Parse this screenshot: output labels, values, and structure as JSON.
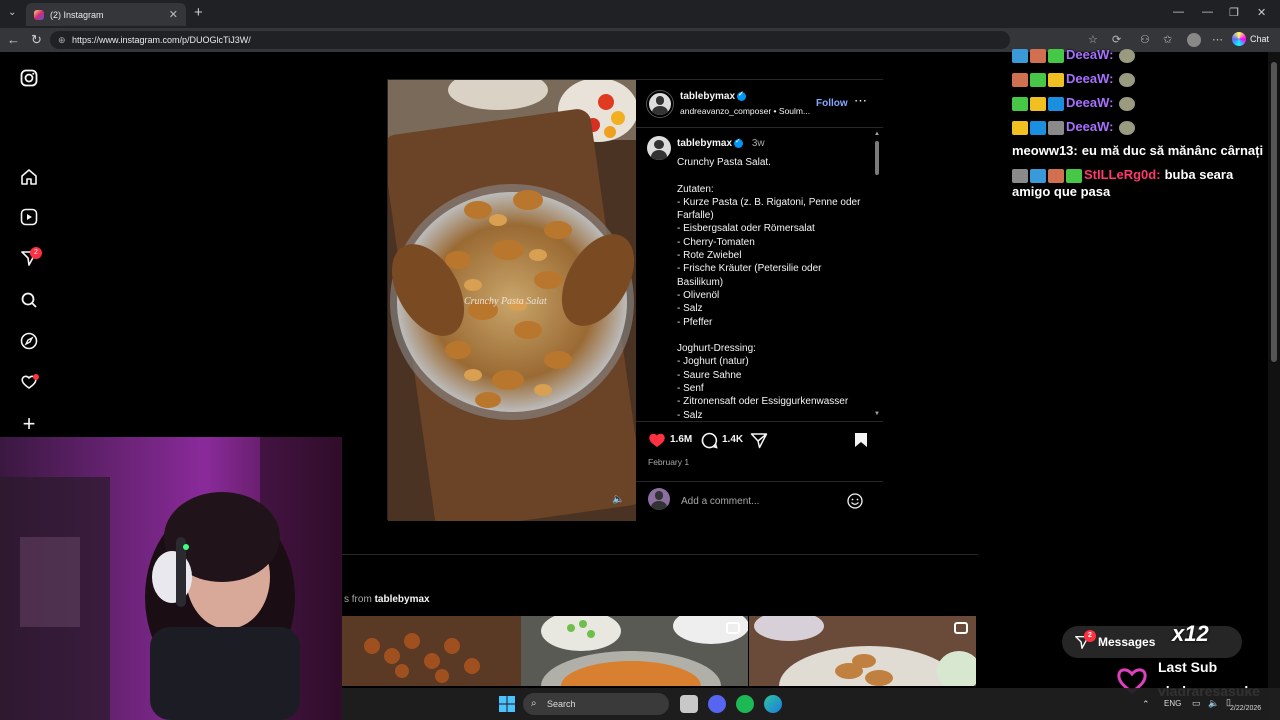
{
  "browser": {
    "tab_title": "(2) Instagram",
    "url": "https://www.instagram.com/p/DUOGlcTiJ3W/",
    "chat_label": "Chat"
  },
  "sidebar": {
    "items": [
      "instagram-logo",
      "home",
      "reels",
      "direct",
      "search",
      "explore",
      "notifications",
      "create"
    ],
    "direct_badge": "2"
  },
  "post": {
    "username": "tablebymax",
    "audio": "andreavanzo_composer • Soulm...",
    "follow_label": "Follow",
    "caption_user": "tablebymax",
    "caption_time": "3w",
    "media_overlay_text": "Crunchy Pasta Salat",
    "caption": "Crunchy Pasta Salat.\n\nZutaten:\n- Kurze Pasta (z. B. Rigatoni, Penne oder Farfalle)\n- Eisbergsalat oder Römersalat\n- Cherry-Tomaten\n- Rote Zwiebel\n- Frische Kräuter (Petersilie oder Basilikum)\n- Olivenöl\n- Salz\n- Pfeffer\n\nJoghurt-Dressing:\n- Joghurt (natur)\n- Saure Sahne\n- Senf\n- Zitronensaft oder Essiggurkenwasser\n- Salz\n- Pfeffer",
    "likes": "1.6M",
    "comments": "1.4K",
    "date": "February 1",
    "comment_placeholder": "Add a comment..."
  },
  "more_posts": {
    "label_prefix": "s from",
    "label_user": "tablebymax"
  },
  "chat": {
    "lines": [
      {
        "user": "DeeaW:",
        "user_color": "#a970ff",
        "text": ""
      },
      {
        "user": "DeeaW:",
        "user_color": "#a970ff",
        "text": ""
      },
      {
        "user": "DeeaW:",
        "user_color": "#a970ff",
        "text": ""
      },
      {
        "user": "DeeaW:",
        "user_color": "#a970ff",
        "text": ""
      },
      {
        "user": "meoww13:",
        "user_color": "#ffffff",
        "text": "eu mă duc să mănânc cârnați"
      },
      {
        "user": "StILLeRg0d:",
        "user_color": "#ff3a6a",
        "text": "buba seara amigo que pasa"
      }
    ]
  },
  "messages_label": "Messages",
  "messages_badge": "2",
  "x12_label": "x12",
  "last_sub": {
    "label": "Last Sub",
    "name": "vladraresasuke"
  },
  "taskbar": {
    "search_label": "Search",
    "lang": "ENG",
    "time": "",
    "date": "2/22/2026"
  }
}
